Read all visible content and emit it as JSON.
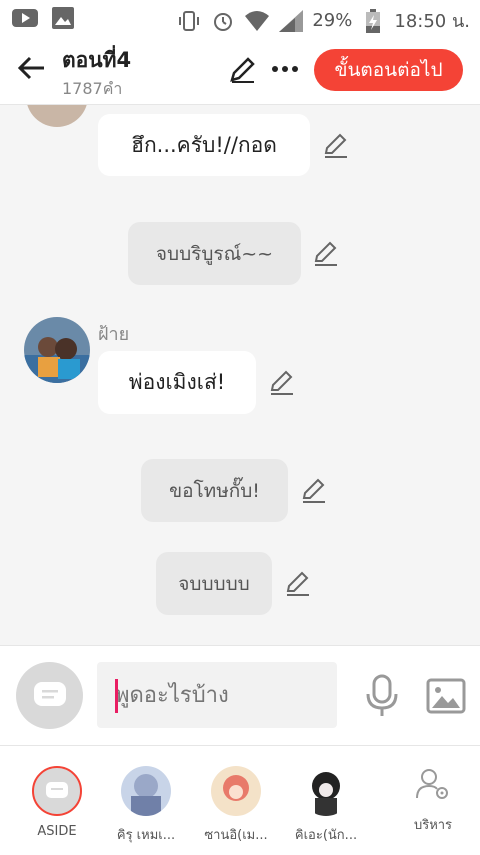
{
  "status_bar": {
    "battery": "29%",
    "time": "18:50 น."
  },
  "header": {
    "title": "ตอนที่4",
    "subtitle": "1787คำ",
    "next_label": "ขั้นตอนต่อไป"
  },
  "messages": [
    {
      "type": "speech",
      "text": "ฮึก...ครับ!//กอด"
    },
    {
      "type": "narration",
      "text": "จบบริบูรณ์~~"
    },
    {
      "type": "speech",
      "speaker": "ฝ้าย",
      "text": "พ่องเมิงเส่!"
    },
    {
      "type": "narration",
      "text": "ขอโทษกั๊บ!"
    },
    {
      "type": "narration",
      "text": "จบบบบบ"
    }
  ],
  "composer": {
    "placeholder": "พูดอะไรบ้าง"
  },
  "characters": [
    {
      "label": "ASIDE"
    },
    {
      "label": "คิรุ เหมเ..."
    },
    {
      "label": "ซานอิ(เม..."
    },
    {
      "label": "คิเอะ(นัก..."
    },
    {
      "label": "บริหาร"
    }
  ],
  "colors": {
    "accent": "#f44336",
    "caret": "#e91e63"
  }
}
